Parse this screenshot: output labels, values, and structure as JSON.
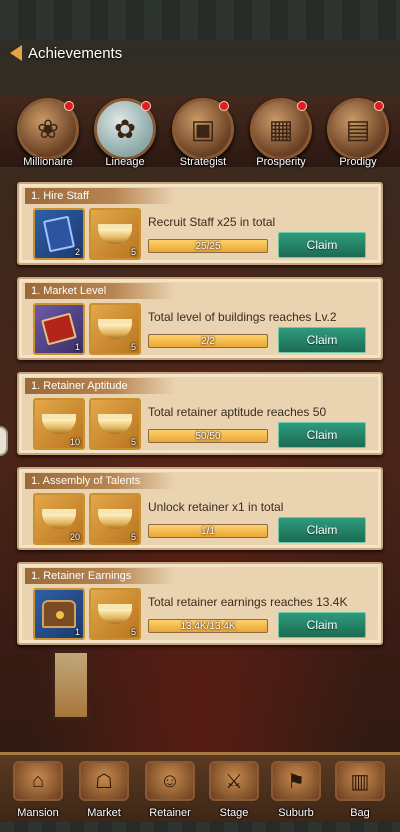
{
  "header": {
    "title": "Achievements",
    "back_icon": "back-arrow-icon"
  },
  "categories": [
    {
      "label": "Millionaire",
      "icon": "money-pot-icon",
      "has_dot": true
    },
    {
      "label": "Lineage",
      "icon": "plate-icon",
      "has_dot": true
    },
    {
      "label": "Strategist",
      "icon": "chest-icon",
      "has_dot": true
    },
    {
      "label": "Prosperity",
      "icon": "abacus-icon",
      "has_dot": true
    },
    {
      "label": "Prodigy",
      "icon": "book-icon",
      "has_dot": true
    }
  ],
  "achievements": [
    {
      "tag": "1. Hire Staff",
      "rewards": [
        {
          "icon": "blue-book-icon",
          "qty": "2",
          "style": "blue"
        },
        {
          "icon": "gold-ingot-icon",
          "qty": "5",
          "style": "gold"
        }
      ],
      "task": "Recruit Staff x25 in total",
      "progress_text": "25/25",
      "progress": 1.0,
      "claim": "Claim"
    },
    {
      "tag": "1. Market Level",
      "rewards": [
        {
          "icon": "red-book-icon",
          "qty": "1",
          "style": "purple"
        },
        {
          "icon": "gold-ingot-icon",
          "qty": "5",
          "style": "gold"
        }
      ],
      "task": "Total level of buildings reaches Lv.2",
      "progress_text": "2/2",
      "progress": 1.0,
      "claim": "Claim"
    },
    {
      "tag": "1. Retainer Aptitude",
      "rewards": [
        {
          "icon": "gold-ingot-icon",
          "qty": "10",
          "style": "gold"
        },
        {
          "icon": "gold-ingot-icon",
          "qty": "5",
          "style": "gold"
        }
      ],
      "task": "Total retainer aptitude reaches 50",
      "progress_text": "50/50",
      "progress": 1.0,
      "claim": "Claim"
    },
    {
      "tag": "1. Assembly of Talents",
      "rewards": [
        {
          "icon": "gold-ingot-icon",
          "qty": "20",
          "style": "gold"
        },
        {
          "icon": "gold-ingot-icon",
          "qty": "5",
          "style": "gold"
        }
      ],
      "task": "Unlock  retainer x1 in total",
      "progress_text": "1/1",
      "progress": 1.0,
      "claim": "Claim"
    },
    {
      "tag": "1. Retainer Earnings",
      "rewards": [
        {
          "icon": "treasure-chest-icon",
          "qty": "1",
          "style": "blue"
        },
        {
          "icon": "gold-ingot-icon",
          "qty": "5",
          "style": "gold"
        }
      ],
      "task": "Total retainer earnings reaches 13.4K",
      "progress_text": "13.4K/13.4K",
      "progress": 1.0,
      "claim": "Claim"
    }
  ],
  "nav": [
    {
      "label": "Mansion",
      "icon": "mansion-icon"
    },
    {
      "label": "Market",
      "icon": "market-icon"
    },
    {
      "label": "Retainer",
      "icon": "retainer-icon"
    },
    {
      "label": "Stage",
      "icon": "stage-icon"
    },
    {
      "label": "Suburb",
      "icon": "suburb-icon"
    },
    {
      "label": "Bag",
      "icon": "bag-icon"
    }
  ]
}
